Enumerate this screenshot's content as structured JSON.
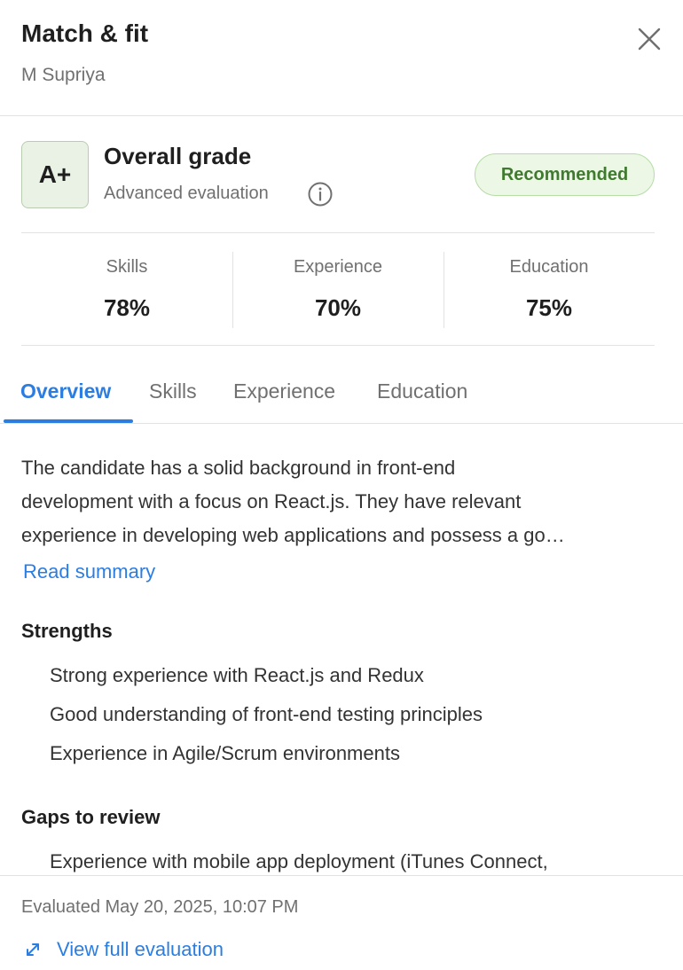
{
  "header": {
    "title": "Match & fit",
    "candidate_name": "M Supriya",
    "close_icon": "close-icon"
  },
  "grade": {
    "value": "A+",
    "title": "Overall grade",
    "subtitle": "Advanced evaluation",
    "info_icon": "info-icon",
    "badge": "Recommended",
    "badge_color": "#3f7a2e"
  },
  "metrics": [
    {
      "label": "Skills",
      "value": "78%"
    },
    {
      "label": "Experience",
      "value": "70%"
    },
    {
      "label": "Education",
      "value": "75%"
    }
  ],
  "tabs": [
    {
      "label": "Overview",
      "active": true
    },
    {
      "label": "Skills",
      "active": false
    },
    {
      "label": "Experience",
      "active": false
    },
    {
      "label": "Education",
      "active": false
    }
  ],
  "overview": {
    "summary_lines": [
      "The candidate has a solid background in front-end",
      "development with a focus on React.js. They have relevant",
      "experience in developing web applications and possess a go…"
    ],
    "read_summary": "Read summary",
    "strengths_title": "Strengths",
    "strengths": [
      "Strong experience with React.js and Redux",
      "Good understanding of front-end testing principles",
      "Experience in Agile/Scrum environments"
    ],
    "gaps_title": "Gaps to review",
    "gaps": [
      "Experience with mobile app deployment (iTunes Connect,"
    ]
  },
  "footer": {
    "evaluated": "Evaluated May 20, 2025, 10:07 PM",
    "view_full": "View full evaluation",
    "expand_icon": "expand-icon"
  },
  "colors": {
    "accent": "#2b7de1",
    "grade_bg": "#eaf1e5",
    "badge_bg": "#ecf7e6"
  }
}
